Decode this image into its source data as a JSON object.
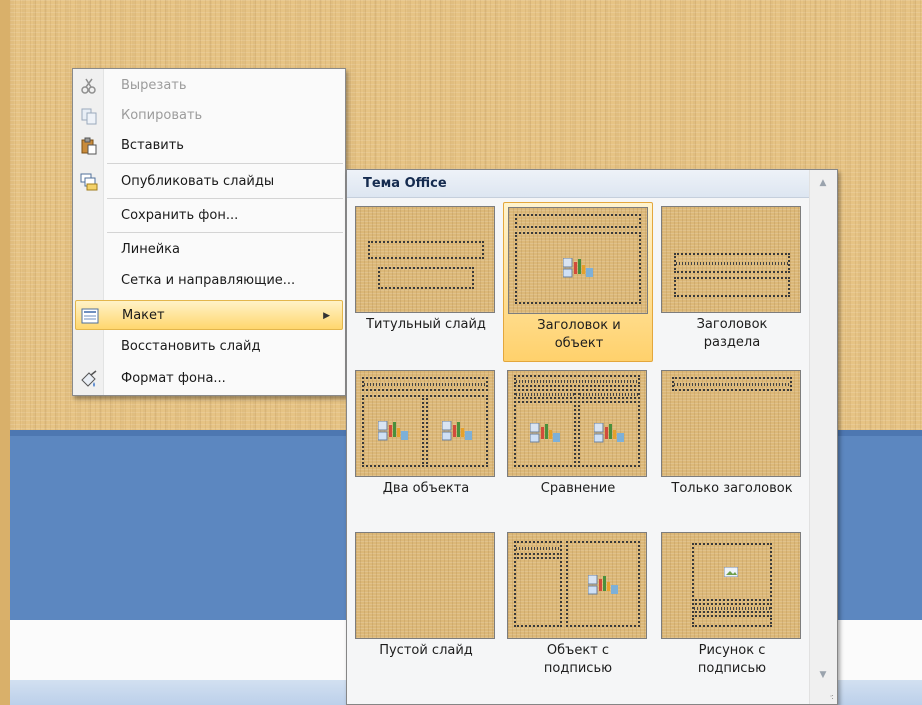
{
  "context_menu": {
    "items": [
      {
        "label": "Вырезать",
        "icon": "scissors-icon",
        "disabled": true
      },
      {
        "label": "Копировать",
        "icon": "copy-icon",
        "disabled": true
      },
      {
        "label": "Вставить",
        "icon": "paste-icon",
        "disabled": false
      },
      {
        "label": "Опубликовать слайды",
        "icon": "publish-slides-icon",
        "disabled": false
      },
      {
        "label": "Сохранить фон...",
        "icon": "",
        "disabled": false
      },
      {
        "label": "Линейка",
        "icon": "",
        "disabled": false
      },
      {
        "label": "Сетка и направляющие...",
        "icon": "",
        "disabled": false
      },
      {
        "label": "Макет",
        "icon": "layout-icon",
        "disabled": false,
        "highlighted": true,
        "submenu": true
      },
      {
        "label": "Восстановить слайд",
        "icon": "",
        "disabled": false
      },
      {
        "label": "Формат фона...",
        "icon": "format-background-icon",
        "disabled": false
      }
    ]
  },
  "gallery": {
    "title": "Тема Office",
    "layouts": [
      {
        "name": "title-slide",
        "caption_lines": [
          "Титульный слайд"
        ]
      },
      {
        "name": "title-and-content",
        "caption_lines": [
          "Заголовок и",
          "объект"
        ],
        "selected": true
      },
      {
        "name": "section-header",
        "caption_lines": [
          "Заголовок",
          "раздела"
        ]
      },
      {
        "name": "two-content",
        "caption_lines": [
          "Два объекта"
        ]
      },
      {
        "name": "comparison",
        "caption_lines": [
          "Сравнение"
        ]
      },
      {
        "name": "title-only",
        "caption_lines": [
          "Только заголовок"
        ]
      },
      {
        "name": "blank",
        "caption_lines": [
          "Пустой слайд"
        ]
      },
      {
        "name": "content-with-caption",
        "caption_lines": [
          "Объект с",
          "подписью"
        ]
      },
      {
        "name": "picture-with-caption",
        "caption_lines": [
          "Рисунок с",
          "подписью"
        ]
      }
    ]
  },
  "colors": {
    "slide_background": "#e6c384",
    "slide_blue": "#5c87c0",
    "highlight": "#ffd76e"
  }
}
